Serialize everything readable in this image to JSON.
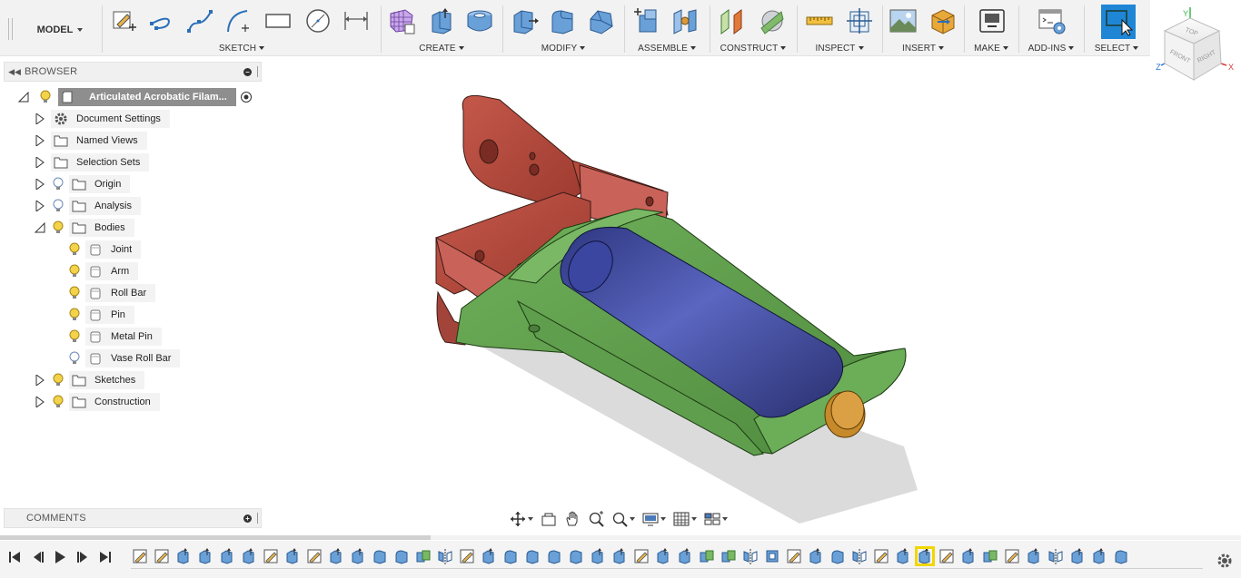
{
  "toolbar": {
    "workspace": "MODEL",
    "groups": [
      {
        "label": "SKETCH"
      },
      {
        "label": "CREATE"
      },
      {
        "label": "MODIFY"
      },
      {
        "label": "ASSEMBLE"
      },
      {
        "label": "CONSTRUCT"
      },
      {
        "label": "INSPECT"
      },
      {
        "label": "INSERT"
      },
      {
        "label": "MAKE"
      },
      {
        "label": "ADD-INS"
      },
      {
        "label": "SELECT"
      }
    ]
  },
  "viewcube": {
    "top": "TOP",
    "front": "FRONT",
    "right": "RIGHT",
    "axis_x": "X",
    "axis_y": "Y",
    "axis_z": "Z"
  },
  "browser": {
    "title": "BROWSER",
    "root": "Articulated Acrobatic Filam...",
    "items": [
      {
        "label": "Document Settings"
      },
      {
        "label": "Named Views"
      },
      {
        "label": "Selection Sets"
      },
      {
        "label": "Origin"
      },
      {
        "label": "Analysis"
      },
      {
        "label": "Bodies"
      },
      {
        "label": "Joint"
      },
      {
        "label": "Arm"
      },
      {
        "label": "Roll Bar"
      },
      {
        "label": "Pin"
      },
      {
        "label": "Metal Pin"
      },
      {
        "label": "Vase Roll Bar"
      },
      {
        "label": "Sketches"
      },
      {
        "label": "Construction"
      }
    ]
  },
  "comments": {
    "title": "COMMENTS"
  },
  "colors": {
    "joint_body": "#b84a3c",
    "arm_body": "#5f9e4d",
    "roll_bar": "#3d4b9e",
    "pin": "#d89a3a",
    "select_highlight": "#1f86d6",
    "timeline_active": "#f2d600"
  },
  "timeline": {
    "features": [
      "sketch",
      "sketch",
      "extrude",
      "extrude",
      "extrude",
      "extrude",
      "sketch",
      "extrude",
      "sketch",
      "extrude",
      "extrude",
      "fillet",
      "fillet",
      "combine",
      "mirror",
      "sketch",
      "extrude",
      "fillet",
      "fillet",
      "fillet",
      "fillet",
      "extrude",
      "extrude",
      "sketch",
      "extrude",
      "extrude",
      "combine",
      "combine",
      "mirror",
      "shell",
      "sketch",
      "extrude",
      "fillet",
      "mirror",
      "sketch",
      "extrude",
      "extrude",
      "sketch",
      "extrude",
      "combine",
      "sketch",
      "extrude",
      "mirror",
      "extrude",
      "extrude",
      "fillet"
    ],
    "active_index": 36
  }
}
